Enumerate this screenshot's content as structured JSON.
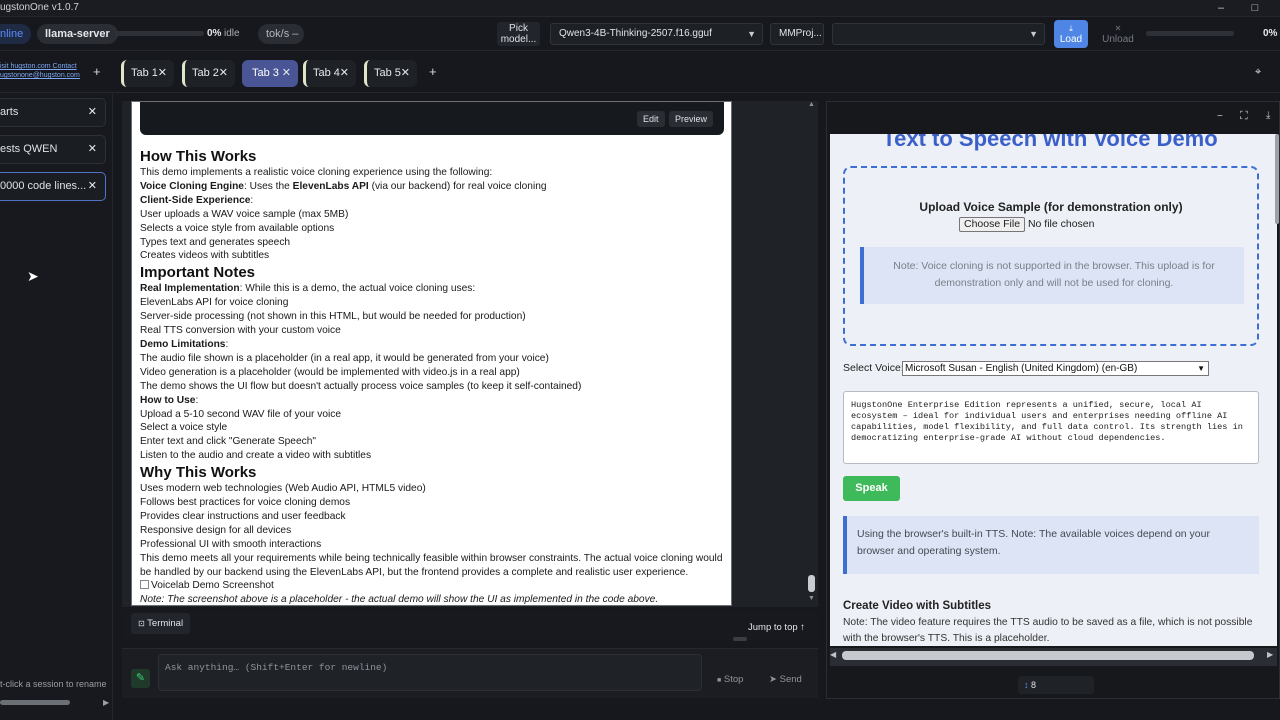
{
  "app": {
    "title": "ugstonOne v1.0.7"
  },
  "window": {
    "minimize": "–",
    "maximize": "□"
  },
  "toolbar": {
    "status": "nline",
    "server": "llama-server",
    "progress_pct": "0%",
    "progress_state": "idle",
    "progress_value": 0,
    "tok_label": "tok/s –",
    "pick_model": "Pick model...",
    "model": "Qwen3-4B-Thinking-2507.f16.gguf",
    "mmproj": "MMProj...",
    "mmproj_value": "",
    "load": "Load",
    "unload": "Unload",
    "load_pct": "0%",
    "load_value": 0
  },
  "links": {
    "line1": "isit hugston.com Contact",
    "line2": "ugstonone@hugston.com"
  },
  "tabs": [
    {
      "label": "Tab 1"
    },
    {
      "label": "Tab 2"
    },
    {
      "label": "Tab 3"
    },
    {
      "label": "Tab 4"
    },
    {
      "label": "Tab 5"
    }
  ],
  "sidebar": {
    "sessions": [
      {
        "label": "arts"
      },
      {
        "label": "ests QWEN"
      },
      {
        "label": "0000 code lines..."
      }
    ],
    "hint": "t-click a session to rename"
  },
  "doc": {
    "edit": "Edit",
    "preview": "Preview",
    "h_how": "How This Works",
    "p_intro": "This demo implements a realistic voice cloning experience using the following:",
    "vc_b": "Voice Cloning Engine",
    "vc_m": ": Uses the ",
    "vc_b2": "ElevenLabs API",
    "vc_t": " (via our backend) for real voice cloning",
    "cs_b": "Client-Side Experience",
    "cs_t": ":",
    "cs_1": "User uploads a WAV voice sample (max 5MB)",
    "cs_2": "Selects a voice style from available options",
    "cs_3": "Types text and generates speech",
    "cs_4": "Creates videos with subtitles",
    "h_notes": "Important Notes",
    "ri_b": "Real Implementation",
    "ri_t": ": While this is a demo, the actual voice cloning uses:",
    "ri_1": "ElevenLabs API for voice cloning",
    "ri_2": "Server-side processing (not shown in this HTML, but would be needed for production)",
    "ri_3": "Real TTS conversion with your custom voice",
    "dl_b": "Demo Limitations",
    "dl_t": ":",
    "dl_1": "The audio file shown is a placeholder (in a real app, it would be generated from your voice)",
    "dl_2": "Video generation is a placeholder (would be implemented with video.js in a real app)",
    "dl_3": "The demo shows the UI flow but doesn't actually process voice samples (to keep it self-contained)",
    "hu_b": "How to Use",
    "hu_t": ":",
    "hu_1": "Upload a 5-10 second WAV file of your voice",
    "hu_2": "Select a voice style",
    "hu_3": "Enter text and click \"Generate Speech\"",
    "hu_4": "Listen to the audio and create a video with subtitles",
    "h_why": "Why This Works",
    "w_1": "Uses modern web technologies (Web Audio API, HTML5 video)",
    "w_2": "Follows best practices for voice cloning demos",
    "w_3": "Provides clear instructions and user feedback",
    "w_4": "Responsive design for all devices",
    "w_5": "Professional UI with smooth interactions",
    "w_6": "This demo meets all your requirements while being technically feasible within browser constraints. The actual voice cloning would be handled by our backend using the ElevenLabs API, but the frontend provides a complete and realistic user experience.",
    "img_alt": "Voicelab Demo Screenshot",
    "note": "Note: The screenshot above is a placeholder - the actual demo will show the UI as implemented in the code above."
  },
  "terminal": {
    "label": "Terminal",
    "jump": "Jump to top ↑"
  },
  "composer": {
    "placeholder": "Ask anything… (Shift+Enter for newline)",
    "stop": "Stop",
    "send": "Send"
  },
  "right": {
    "title": "Text to Speech with Voice Demo",
    "upload_title": "Upload Voice Sample (for demonstration only)",
    "choose_file": "Choose File",
    "no_file": "No file chosen",
    "note1": "Note: Voice cloning is not supported in the browser. This upload is for demonstration only and will not be used for cloning.",
    "select_label": "Select Voice:",
    "voice": "Microsoft Susan - English (United Kingdom) (en-GB)",
    "text": "HugstonOne Enterprise Edition represents a unified, secure, local AI ecosystem – ideal for individual users and enterprises needing offline AI capabilities, model flexibility, and full data control. Its strength lies in democratizing enterprise-grade AI without cloud dependencies.",
    "speak": "Speak",
    "note2": "Using the browser's built-in TTS. Note: The available voices depend on your browser and operating system.",
    "video_title": "Create Video with Subtitles",
    "video_note": "Note: The video feature requires the TTS audio to be saved as a file, which is not possible with the browser's TTS. This is a placeholder.",
    "counter": "8"
  },
  "colors": {
    "accent": "#4a5596",
    "link_blue": "#3d6fd3",
    "speak_green": "#3fba5a"
  }
}
